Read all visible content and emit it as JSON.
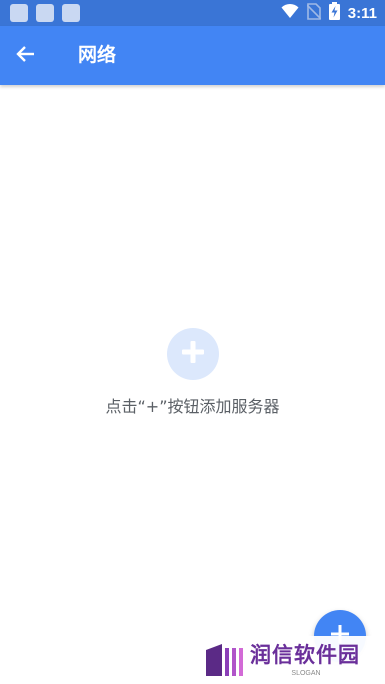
{
  "status_bar": {
    "time": "3:11",
    "icons": [
      "notification-icon",
      "notification-icon",
      "notification-icon",
      "wifi-icon",
      "no-sim-icon",
      "battery-charging-icon"
    ]
  },
  "app_bar": {
    "title": "网络",
    "back_icon": "arrow-back-icon"
  },
  "empty_state": {
    "icon": "plus-icon",
    "message": "点击“+”按钮添加服务器"
  },
  "fab": {
    "icon": "plus-icon"
  },
  "watermark": {
    "text": "润信软件园",
    "slogan": "SLOGAN"
  },
  "colors": {
    "status_bar": "#3a75d6",
    "app_bar": "#4285f4",
    "empty_icon_bg": "#dce8fc",
    "fab": "#4285f4",
    "watermark_text": "#6a2f9a"
  }
}
